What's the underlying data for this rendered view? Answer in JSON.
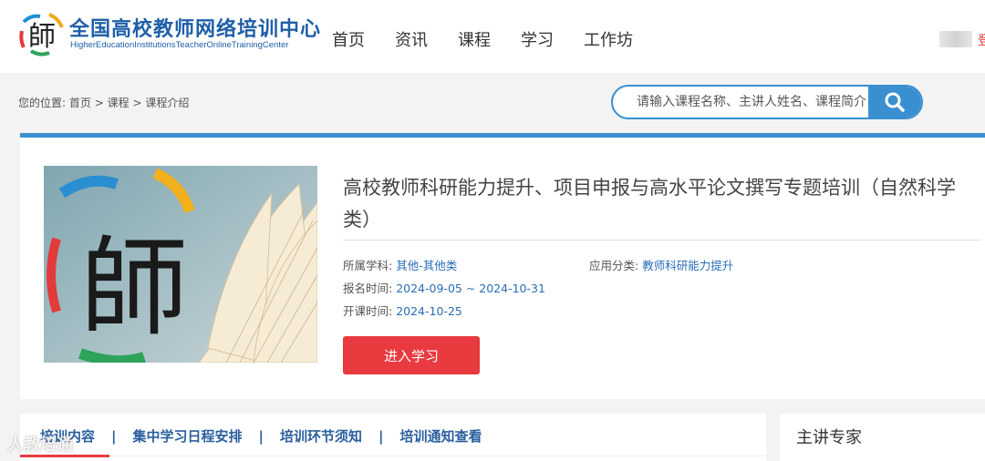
{
  "header": {
    "brand_title": "全国高校教师网络培训中心",
    "brand_subtitle": "HigherEducationInstitutionsTeacherOnlineTrainingCenter",
    "nav": [
      "首页",
      "资讯",
      "课程",
      "学习",
      "工作坊"
    ],
    "user_fragment": "登"
  },
  "breadcrumb": {
    "prefix": "您的位置:",
    "items": [
      "首页",
      "课程",
      "课程介绍"
    ],
    "separator": ">"
  },
  "search": {
    "placeholder": "请输入课程名称、主讲人姓名、课程简介",
    "icon": "search-icon"
  },
  "course": {
    "title": "高校教师科研能力提升、项目申报与高水平论文撰写专题培训（自然科学类）",
    "subject_label": "所属学科:",
    "subject_value": "其他-其他类",
    "category_label": "应用分类:",
    "category_value": "教师科研能力提升",
    "enroll_label": "报名时间:",
    "enroll_value": "2024-09-05 ~ 2024-10-31",
    "start_label": "开课时间:",
    "start_value": "2024-10-25",
    "enter_button": "进入学习",
    "image_char": "師"
  },
  "tabs": {
    "items": [
      "培训内容",
      "集中学习日程安排",
      "培训环节须知",
      "培训通知查看"
    ],
    "separator": "|",
    "active_index": 0
  },
  "expert": {
    "title": "主讲专家"
  },
  "watermark": "人教培通",
  "colors": {
    "brand_blue": "#1f5fa8",
    "accent_blue": "#3a8fd1",
    "link_blue": "#2a6db5",
    "button_red": "#e83a3f"
  }
}
